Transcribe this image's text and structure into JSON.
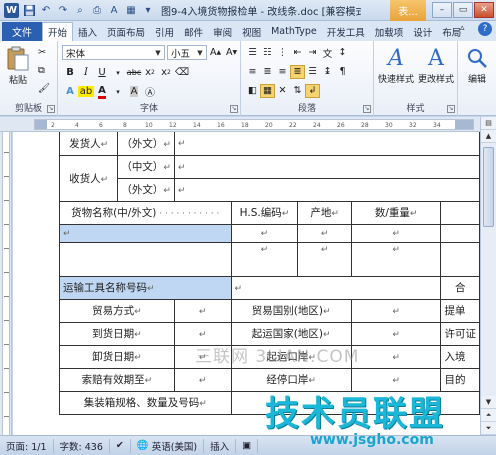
{
  "titlebar": {
    "app_icon": "W",
    "title": "图9-4入境货物报检单 - 改线条.doc [兼容模式] M...",
    "context_tab": "表...",
    "qat_icons": [
      "save-icon",
      "undo-icon",
      "redo-icon",
      "print-preview-icon",
      "print-icon",
      "font-color-icon",
      "table-icon",
      "customize-icon"
    ]
  },
  "tabs": [
    "文件",
    "开始",
    "插入",
    "页面布局",
    "引用",
    "邮件",
    "审阅",
    "视图",
    "MathType",
    "开发工具",
    "加载项",
    "设计",
    "布局"
  ],
  "ribbon": {
    "clipboard": {
      "paste": "粘贴",
      "label": "剪贴板"
    },
    "font": {
      "name": "宋体",
      "size": "小五",
      "label": "字体"
    },
    "paragraph": {
      "label": "段落"
    },
    "styles": {
      "quick_styles": "快速样式",
      "change_styles": "更改样式",
      "label": "样式"
    },
    "editing": {
      "label": "编辑"
    }
  },
  "document": {
    "rows": {
      "consignor": "发货人",
      "consignor_foreign": "（外文）",
      "consignee": "收货人",
      "consignee_chinese": "（中文）",
      "consignee_foreign": "（外文）",
      "goods_name": "货物名称(中/外文)",
      "hs_code": "H.S.编码",
      "origin": "产地",
      "quantity": "数/重量",
      "transport": "运输工具名称号码",
      "contract_partial": "合",
      "trade_mode": "贸易方式",
      "trade_country": "贸易国别(地区)",
      "bill_partial": "提单",
      "arrival_date": "到货日期",
      "departure_country": "起运国家(地区)",
      "permit_partial": "许可证",
      "unloading_date": "卸货日期",
      "departure_port": "起运口岸",
      "entry_partial": "入境",
      "claim_period": "索赔有效期至",
      "via_port": "经停口岸",
      "dest_partial": "目的",
      "container": "集装箱规格、数量及号码"
    },
    "para_mark": "↵"
  },
  "watermarks": {
    "line1": "三联网 3LIAN.COM",
    "line2": "技术员联盟",
    "line3": "www.jsgho.com"
  },
  "statusbar": {
    "page": "页面: 1/1",
    "words": "字数: 436",
    "language": "英语(美国)",
    "mode": "插入"
  }
}
